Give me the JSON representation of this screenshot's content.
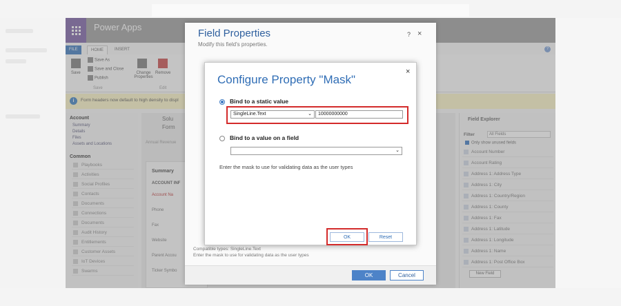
{
  "app": {
    "name": "Power Apps"
  },
  "ribbon": {
    "tabs": [
      "FILE",
      "HOME",
      "INSERT"
    ],
    "save": "Save",
    "save_as": "Save As",
    "save_close": "Save and Close",
    "publish": "Publish",
    "change_properties": "Change Properties",
    "remove": "Remove",
    "group_save": "Save",
    "group_edit": "Edit"
  },
  "infobar": {
    "text": "Form headers now default to high density to displ"
  },
  "nav": {
    "account_header": "Account",
    "account_items": [
      "Summary",
      "Details",
      "Files",
      "Assets and Locations"
    ],
    "common_header": "Common",
    "common_items": [
      "Playbooks",
      "Activities",
      "Social Profiles",
      "Contacts",
      "Documents",
      "Connections",
      "Documents",
      "Audit History",
      "Entitlements",
      "Customer Assets",
      "IoT Devices",
      "Swarms"
    ]
  },
  "form": {
    "solution": "Solu",
    "form_label": "Form",
    "annual_revenue": "Annual Revenue",
    "summary": "Summary",
    "account_info": "ACCOUNT INF",
    "fields": [
      "Account Na",
      "Phone",
      "Fax",
      "Website",
      "Parent Accou",
      "Ticker Symbo"
    ]
  },
  "field_explorer": {
    "title": "Field Explorer",
    "filter_label": "Filter",
    "filter_value": "All Fields",
    "only_unused": "Only show unused fields",
    "fields": [
      "Account Number",
      "Account Rating",
      "Address 1: Address Type",
      "Address 1: City",
      "Address 1: Country/Region",
      "Address 1: County",
      "Address 1: Fax",
      "Address 1: Latitude",
      "Address 1: Longitude",
      "Address 1: Name",
      "Address 1: Post Office Box"
    ],
    "new_field": "New Field"
  },
  "field_properties": {
    "title": "Field Properties",
    "subtitle": "Modify this field's properties.",
    "help": "?",
    "close": "×",
    "compatible": "Compatible types: SingleLine.Text",
    "hint": "Enter the mask to use for validating data as the user types",
    "ok": "OK",
    "cancel": "Cancel"
  },
  "configure": {
    "title": "Configure Property \"Mask\"",
    "close": "×",
    "static_label": "Bind to a static value",
    "static_type": "SingleLine.Text",
    "static_value": "10000000000",
    "field_label": "Bind to a value on a field",
    "field_value": "",
    "description": "Enter the mask to use for validating data as the user types",
    "ok": "OK",
    "reset": "Reset"
  },
  "colors": {
    "accent": "#2f6db5",
    "highlight": "#d32a2a",
    "header": "#9e9e9e",
    "waffle": "#7a5fa6"
  }
}
